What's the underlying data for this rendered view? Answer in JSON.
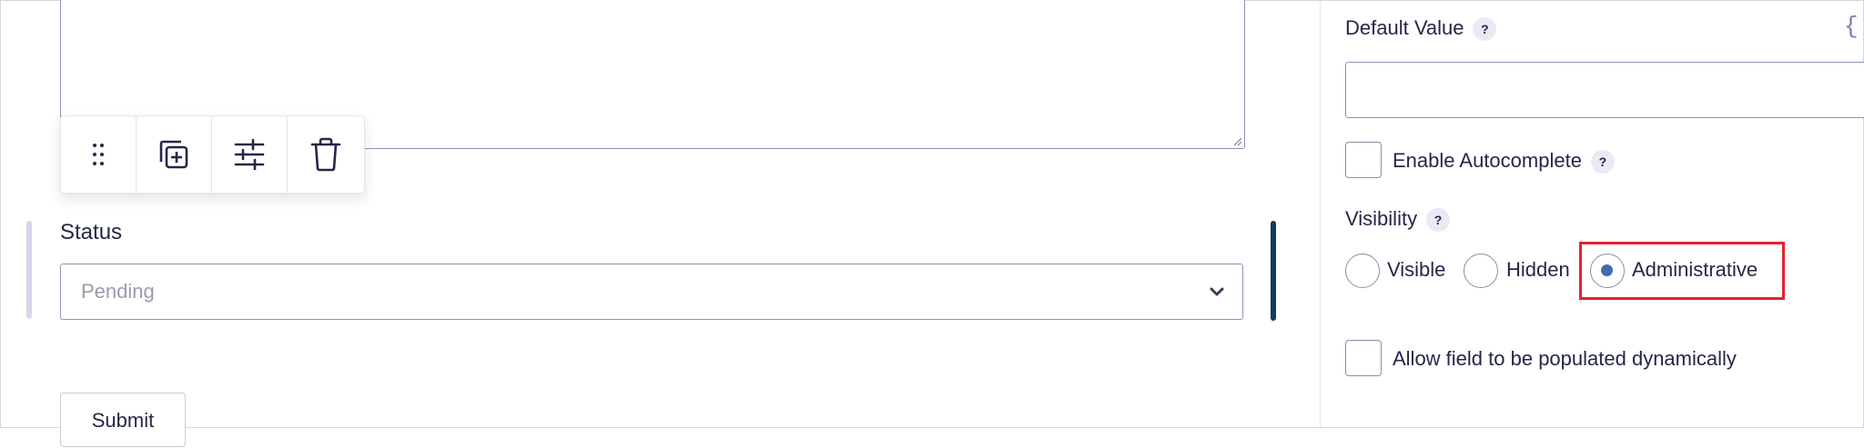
{
  "form": {
    "status_field": {
      "label": "Status",
      "selected_value": "Pending"
    },
    "submit_label": "Submit"
  },
  "toolbar": {
    "items": [
      "drag-handle",
      "duplicate",
      "settings",
      "delete"
    ]
  },
  "settings_panel": {
    "default_value": {
      "label": "Default Value",
      "help": "?",
      "merge_tag_glyph": "{·",
      "value": ""
    },
    "enable_autocomplete": {
      "label": "Enable Autocomplete",
      "help": "?",
      "checked": false
    },
    "visibility": {
      "label": "Visibility",
      "help": "?",
      "options": [
        {
          "label": "Visible",
          "checked": false
        },
        {
          "label": "Hidden",
          "checked": false
        },
        {
          "label": "Administrative",
          "checked": true
        }
      ]
    },
    "dynamic_population": {
      "label": "Allow field to be populated dynamically",
      "checked": false
    }
  },
  "colors": {
    "accent": "#153a5c",
    "radio_dot": "#3d6fb0",
    "highlight": "#e5222f",
    "border": "#9092b2"
  }
}
